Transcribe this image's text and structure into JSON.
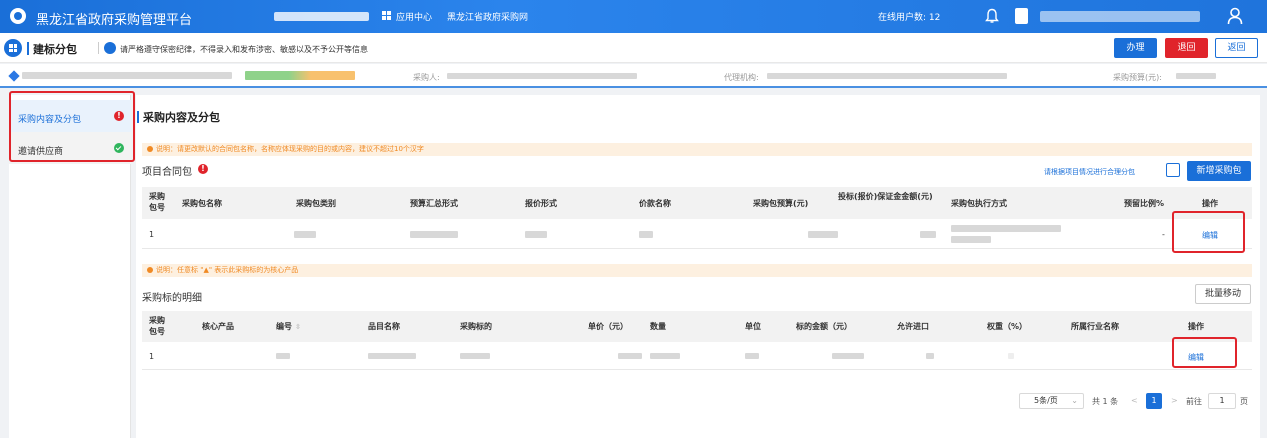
{
  "topbar": {
    "title": "黑龙江省政府采购管理平台",
    "app_center": "应用中心",
    "site_link": "黑龙江省政府采购网",
    "online_users": "在线用户数: 12"
  },
  "subbar": {
    "page_title": "建标分包",
    "notice": "请严格遵守保密纪律，不得录入和发布涉密、敏感以及不予公开等信息",
    "buttons": {
      "handle": "办理",
      "return_back": "退回",
      "go_back": "返回"
    }
  },
  "infobar": {
    "purchaser_label": "采购人:",
    "agency_label": "代理机构:",
    "budget_label": "采购预算(元):"
  },
  "sidebar": {
    "items": [
      {
        "label": "采购内容及分包",
        "status": "error",
        "status_mark": "!"
      },
      {
        "label": "邀请供应商",
        "status": "ok"
      }
    ]
  },
  "section": {
    "title": "采购内容及分包",
    "tip1": "说明：请更改默认的合同包名称，名称应体现采购的目的或内容，建议不超过10个汉字",
    "package_title": "项目合同包",
    "package_mark": "!",
    "hint": "请根据项目情况进行合理分包",
    "add_package": "新增采购包",
    "tip2": "说明：任意标 \"▲\" 表示此采购标的为核心产品",
    "detail_title": "采购标的明细",
    "batch_move": "批量移动"
  },
  "package_table": {
    "headers": [
      "采购包号",
      "采购包名称",
      "采购包类别",
      "预算汇总形式",
      "报价形式",
      "价款名称",
      "采购包预算(元)",
      "投标(报价)保证金金额(元)",
      "采购包执行方式",
      "预留比例%",
      "操作"
    ],
    "rows": [
      {
        "no": "1",
        "reserve": "-",
        "action": "编辑"
      }
    ]
  },
  "detail_table": {
    "headers": [
      "采购包号",
      "核心产品",
      "编号",
      "品目名称",
      "采购标的",
      "单价（元）",
      "数量",
      "单位",
      "标的金额（元）",
      "允许进口",
      "权重（%）",
      "所属行业名称",
      "操作"
    ],
    "sort_icon": "⇳",
    "rows": [
      {
        "no": "1",
        "action": "编辑"
      }
    ]
  },
  "pagination": {
    "page_size": "5条/页",
    "total": "共 1 条",
    "prev": "<",
    "current": "1",
    "next": ">",
    "goto_label": "前往",
    "goto_value": "1",
    "page_unit": "页"
  },
  "colors": {
    "primary": "#1a6fd8",
    "danger": "#e0242b",
    "success": "#2fb55d",
    "warning": "#f08a24"
  }
}
